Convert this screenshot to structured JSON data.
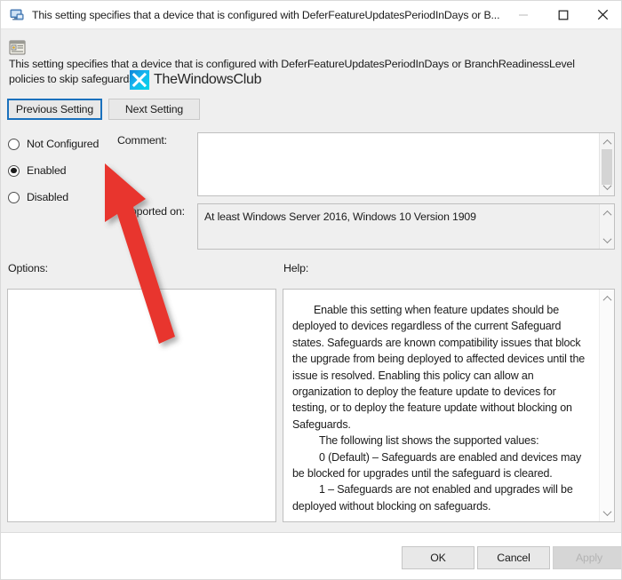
{
  "window": {
    "title": "This setting specifies that a device that is configured with DeferFeatureUpdatesPeriodInDays or B...",
    "icon": "policy-computer-icon",
    "controls": {
      "minimize": "minimize-icon",
      "maximize": "maximize-icon",
      "close": "close-icon"
    },
    "bg_color": "#efefef",
    "titlebar_color": "#ffffff"
  },
  "header": {
    "icon": "policy-setting-icon",
    "description": "This setting specifies that a device that is configured with DeferFeatureUpdatesPeriodInDays or BranchReadinessLevel policies to skip safeguards"
  },
  "watermark": {
    "text": "TheWindowsClub",
    "logo": "thewindowsclub-logo-icon",
    "logo_color": "#18b5ef"
  },
  "nav": {
    "previous_label": "Previous Setting",
    "next_label": "Next Setting",
    "focus_color": "#1a71bd"
  },
  "state": {
    "options": [
      {
        "label": "Not Configured",
        "selected": false
      },
      {
        "label": "Enabled",
        "selected": true
      },
      {
        "label": "Disabled",
        "selected": false
      }
    ]
  },
  "fields": {
    "comment_label": "Comment:",
    "comment_value": "",
    "supported_label": "Supported on:",
    "supported_value": "At least Windows Server 2016, Windows 10 Version 1909"
  },
  "panels": {
    "options_label": "Options:",
    "options_content": "",
    "help_label": "Help:",
    "help_paragraphs": [
      "Enable this setting when feature updates should be deployed to devices regardless of the current Safeguard states. Safeguards are known compatibility issues that block the upgrade from being deployed to affected devices until the issue is resolved. Enabling this policy can allow an organization to deploy the feature update to devices for testing, or to deploy the feature update without blocking on Safeguards.",
      "The following list shows the supported values:",
      "0 (Default) – Safeguards are enabled and devices may be blocked for upgrades until the safeguard is cleared.",
      "1 – Safeguards are not enabled and upgrades will be deployed without blocking on safeguards."
    ]
  },
  "footer": {
    "ok_label": "OK",
    "cancel_label": "Cancel",
    "apply_label": "Apply",
    "apply_disabled": true
  },
  "annotation": {
    "type": "red-arrow",
    "color": "#e8352e",
    "points_at": "Enabled"
  }
}
